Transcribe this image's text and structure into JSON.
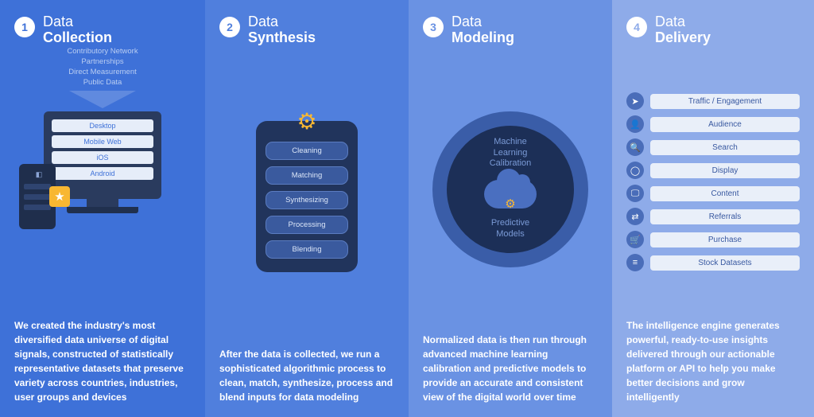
{
  "columns": [
    {
      "num": "1",
      "title_pre": "Data",
      "title_bold": "Collection",
      "sources": [
        "Contributory Network",
        "Partnerships",
        "Direct Measurement",
        "Public Data"
      ],
      "monitor_lines": [
        "Desktop",
        "Mobile Web",
        "iOS",
        "Android"
      ],
      "desc": "We created the industry's most diversified data universe of digital signals, constructed of statistically representative datasets that preserve variety across countries, industries, user groups and devices"
    },
    {
      "num": "2",
      "title_pre": "Data",
      "title_bold": "Synthesis",
      "pills": [
        "Cleaning",
        "Matching",
        "Synthesizing",
        "Processing",
        "Blending"
      ],
      "desc": "After the data is collected, we run a sophisticated algorithmic process to clean, match, synthesize, process and blend inputs for data modeling"
    },
    {
      "num": "3",
      "title_pre": "Data",
      "title_bold": "Modeling",
      "circle_top": "Machine\nLearning\nCalibration",
      "circle_bottom": "Predictive\nModels",
      "desc": "Normalized data is then run through advanced machine learning calibration and predictive models to provide an accurate and consistent view of the digital world over time"
    },
    {
      "num": "4",
      "title_pre": "Data",
      "title_bold": "Delivery",
      "delivery": [
        {
          "icon": "➤",
          "label": "Traffic / Engagement"
        },
        {
          "icon": "👤",
          "label": "Audience"
        },
        {
          "icon": "🔍",
          "label": "Search"
        },
        {
          "icon": "◯",
          "label": "Display"
        },
        {
          "icon": "🖵",
          "label": "Content"
        },
        {
          "icon": "⇄",
          "label": "Referrals"
        },
        {
          "icon": "🛒",
          "label": "Purchase"
        },
        {
          "icon": "≡",
          "label": "Stock Datasets"
        }
      ],
      "desc": "The intelligence engine generates powerful, ready-to-use insights delivered through our actionable platform or API to help you make better decisions and grow intelligently"
    }
  ]
}
